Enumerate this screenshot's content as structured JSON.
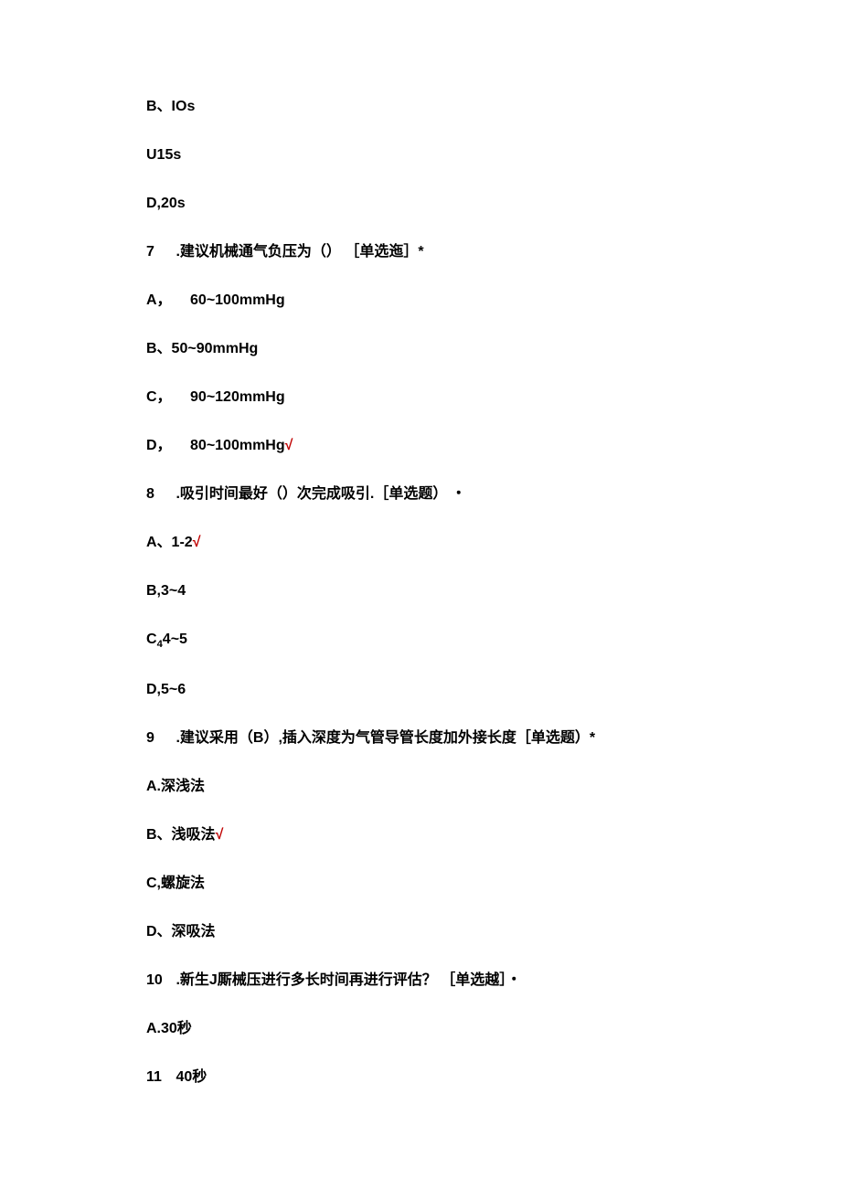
{
  "q6": {
    "optB": "B、IOs",
    "optC": "U15s",
    "optD": "D,20s"
  },
  "q7": {
    "num": "7",
    "text": ".建议机械通气负压为（）  ［单选迤］*",
    "optA_prefix": "A，",
    "optA_val": "60~100mmHg",
    "optB": "B、50~90mmHg",
    "optC_prefix": "C，",
    "optC_val": "90~120mmHg",
    "optD_prefix": "D，",
    "optD_val": "80~100mmHg",
    "check": "√"
  },
  "q8": {
    "num": "8",
    "text": ".吸引时间最好（）次完成吸引.［单选题） ・",
    "optA": "A、1-2",
    "check": "√",
    "optB": "B,3~4",
    "optC_prefix": "C",
    "optC_sub": "4",
    "optC_rest": "4~5",
    "optD": "D,5~6"
  },
  "q9": {
    "num": "9",
    "text": ".建议采用（B）,插入深度为气管导管长度加外接长度［单选题）*",
    "optA": "A.深浅法",
    "optB": "B、浅吸法",
    "check": "√",
    "optC": "C,螺旋法",
    "optD": "D、深吸法"
  },
  "q10": {
    "num": "10",
    "text": ".新生J厮械压进行多长时间再进行评估？  ［单选越］・",
    "optA": "A.30秒",
    "optB_prefix": "11",
    "optB_val": "40秒"
  }
}
